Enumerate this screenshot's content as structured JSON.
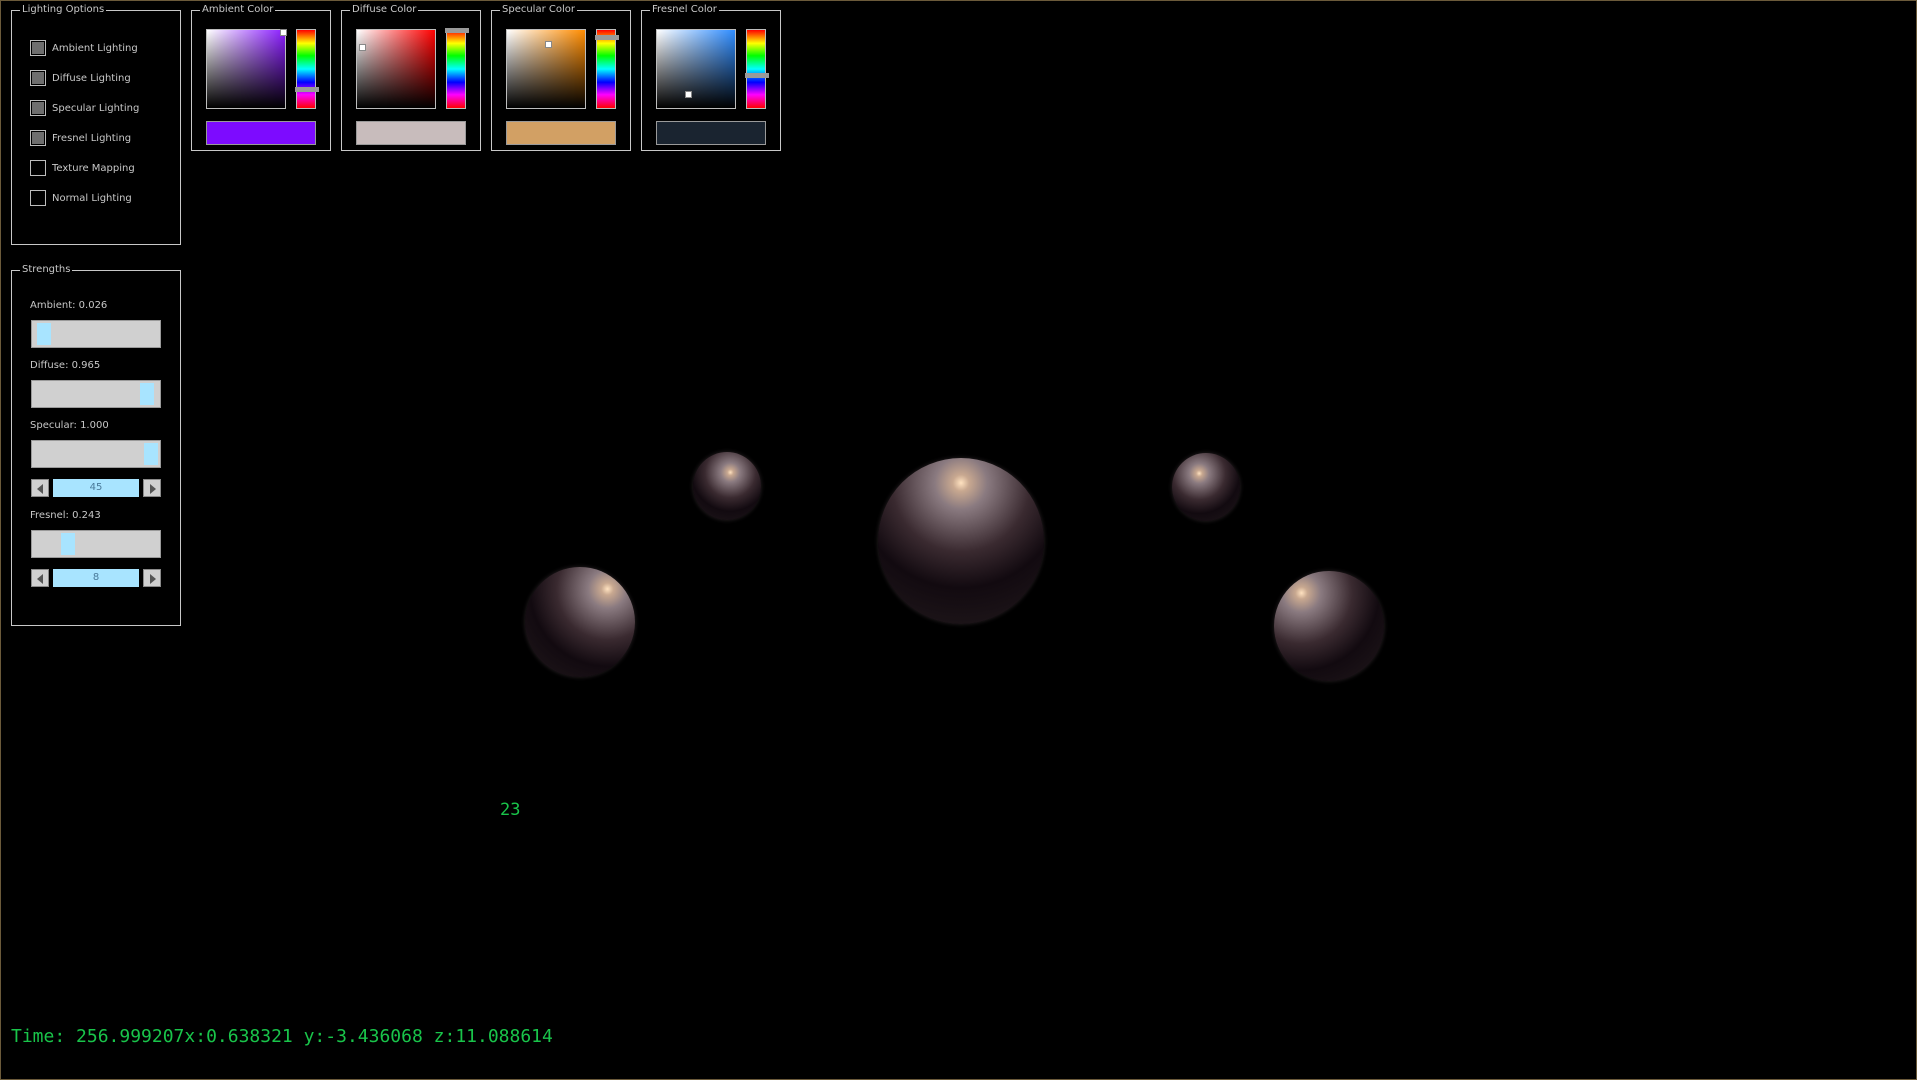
{
  "lighting_options": {
    "legend": "Lighting Options",
    "items": [
      {
        "label": "Ambient Lighting",
        "checked": true
      },
      {
        "label": "Diffuse Lighting",
        "checked": true
      },
      {
        "label": "Specular Lighting",
        "checked": true
      },
      {
        "label": "Fresnel Lighting",
        "checked": true
      },
      {
        "label": "Texture Mapping",
        "checked": false
      },
      {
        "label": "Normal Lighting",
        "checked": false
      }
    ]
  },
  "strengths": {
    "legend": "Strengths",
    "ambient": {
      "label": "Ambient: 0.026",
      "value": 0.026
    },
    "diffuse": {
      "label": "Diffuse: 0.965",
      "value": 0.965
    },
    "specular": {
      "label": "Specular: 1.000",
      "value": 1.0,
      "power": "45"
    },
    "fresnel": {
      "label": "Fresnel: 0.243",
      "value": 0.243,
      "power": "8"
    }
  },
  "color_pickers": [
    {
      "legend": "Ambient Color",
      "swatch": "#7d0bff",
      "hue_base": "#8a1cff",
      "hue": 0.75,
      "sat": 0.97,
      "val": 0.98
    },
    {
      "legend": "Diffuse Color",
      "swatch": "#c8bcbc",
      "hue_base": "#ff0000",
      "hue": 0.0,
      "sat": 0.06,
      "val": 0.78
    },
    {
      "legend": "Specular Color",
      "swatch": "#d2a064",
      "hue_base": "#ff8c00",
      "hue": 0.09,
      "sat": 0.52,
      "val": 0.82
    },
    {
      "legend": "Fresnel Color",
      "swatch": "#1a2430",
      "hue_base": "#2e8cff",
      "hue": 0.58,
      "sat": 0.4,
      "val": 0.18
    }
  ],
  "scene": {
    "sphere_color": "#8a7a80",
    "highlight_color": "#ffe2c0"
  },
  "fps": "23",
  "status": "Time: 256.999207x:0.638321 y:-3.436068 z:11.088614"
}
